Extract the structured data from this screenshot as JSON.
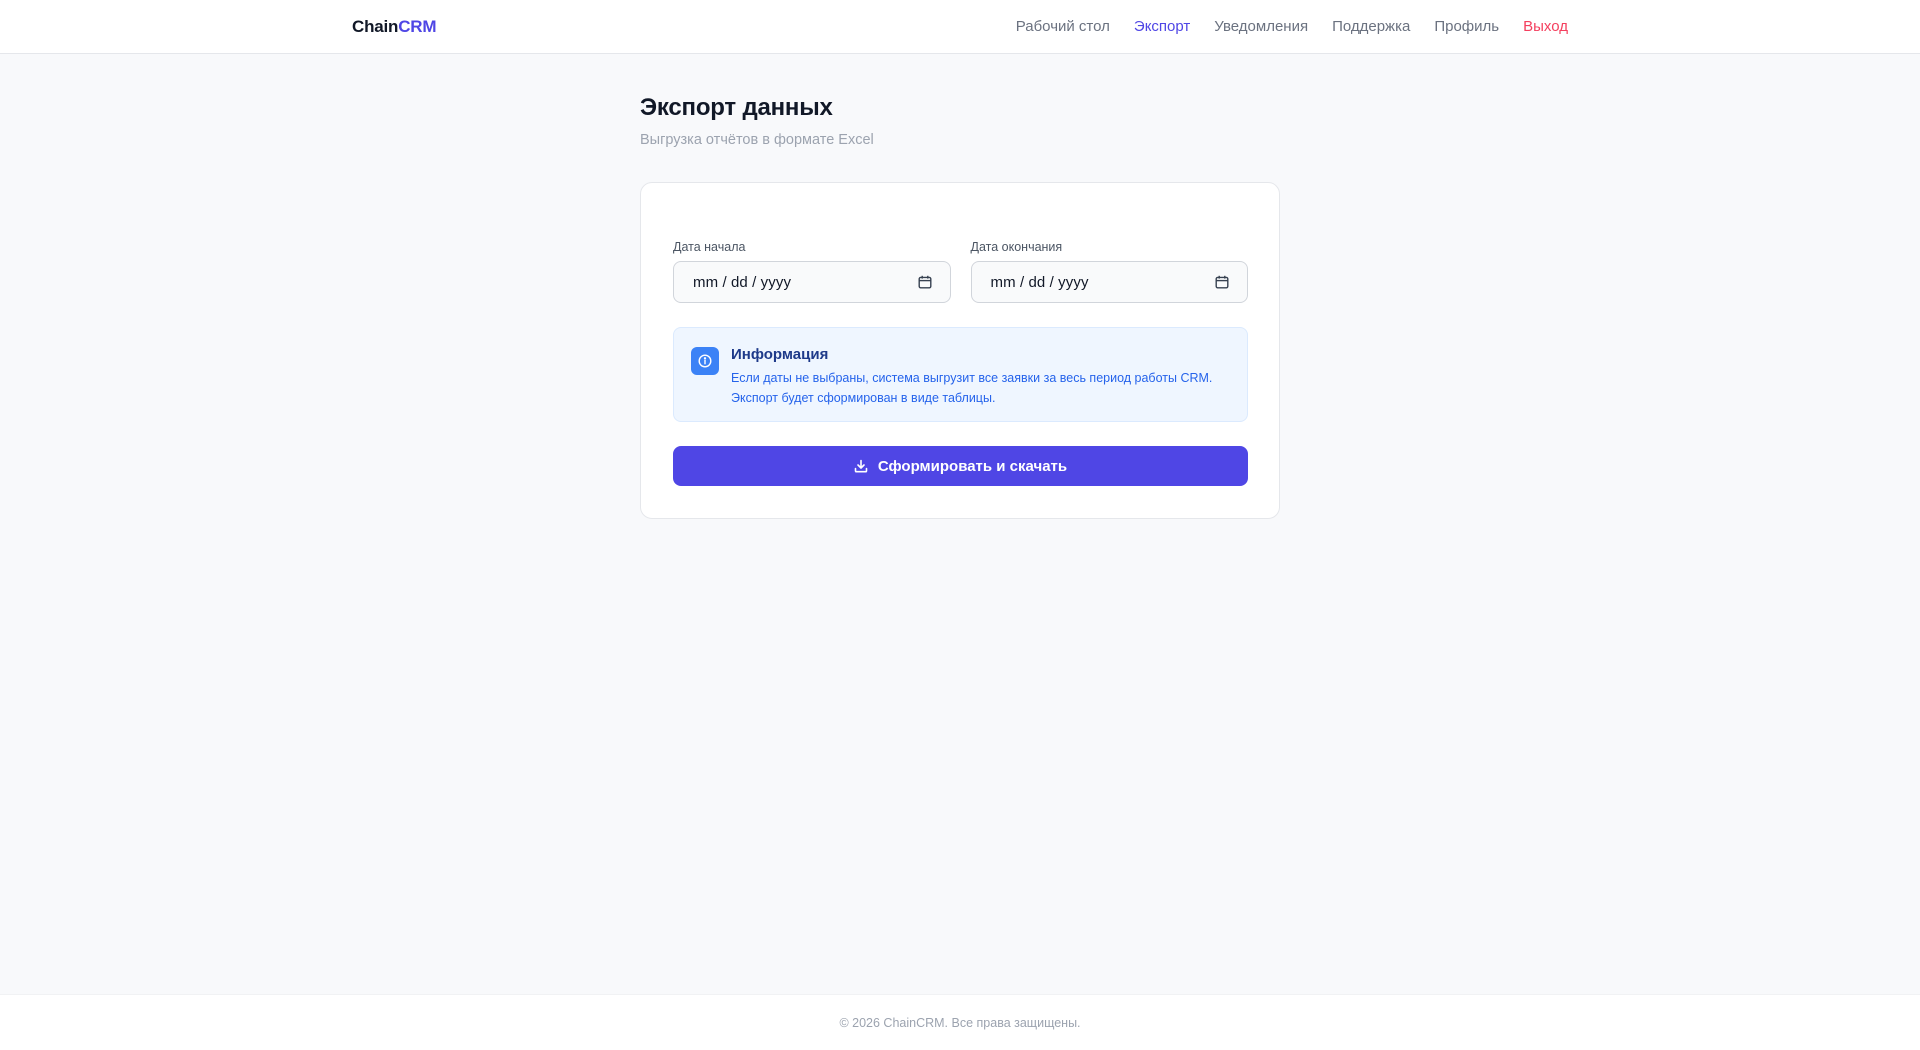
{
  "header": {
    "brand_part1": "Chain",
    "brand_part2": "CRM",
    "nav": [
      {
        "label": "Рабочий стол"
      },
      {
        "label": "Экспорт"
      },
      {
        "label": "Уведомления"
      },
      {
        "label": "Поддержка"
      },
      {
        "label": "Профиль"
      },
      {
        "label": "Выход"
      }
    ],
    "active_item": "Экспорт"
  },
  "page": {
    "title": "Экспорт данных",
    "subtitle": "Выгрузка отчётов в формате Excel"
  },
  "form": {
    "start_date": {
      "label": "Дата начала",
      "value": "mm / dd / yyyy",
      "icon": "calendar-icon"
    },
    "end_date": {
      "label": "Дата окончания",
      "value": "mm / dd / yyyy",
      "icon": "calendar-icon"
    }
  },
  "info": {
    "icon": "info-icon",
    "title": "Информация",
    "line1": "Если даты не выбраны, система выгрузит все заявки за весь период работы CRM.",
    "line2": "Экспорт будет сформирован в виде таблицы."
  },
  "submit": {
    "label": "Сформировать и скачать",
    "icon": "download-icon"
  },
  "footer": {
    "text": "© 2026 ChainCRM. Все права защищены."
  },
  "colors": {
    "accent": "#4f46e5",
    "logout": "#f43f5e",
    "info_bg": "#eff6ff",
    "info_icon": "#3b82f6",
    "background": "#f8f9fb"
  }
}
